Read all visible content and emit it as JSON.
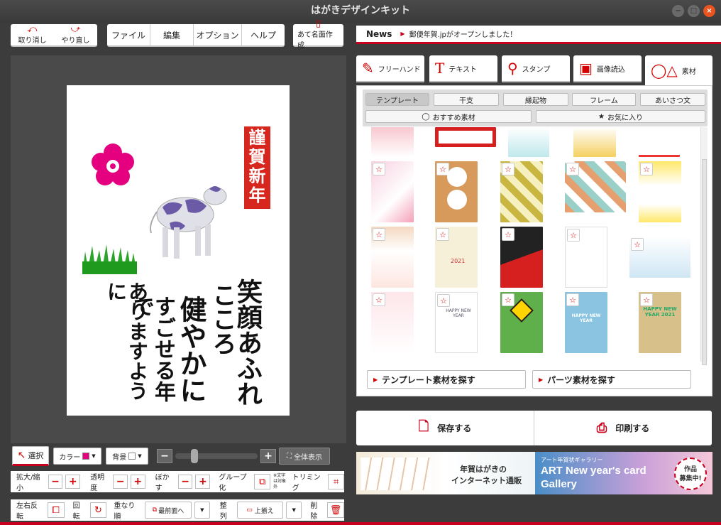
{
  "window": {
    "title": "はがきデザインキット",
    "controls": [
      "−",
      "□",
      "×"
    ]
  },
  "toolbar": {
    "undo_label": "取り消し",
    "redo_label": "やり直し",
    "menus": [
      "ファイル",
      "編集",
      "オプション",
      "ヘルプ"
    ],
    "address_label": "あて名面作成"
  },
  "news": {
    "label": "News",
    "text": "郵便年賀.jpがオープンしました！"
  },
  "card": {
    "stamp_text": "謹賀新年",
    "message_columns": [
      "笑顔あふれ",
      "こころ",
      "健やかに",
      "すごせる年で",
      "ありますように"
    ]
  },
  "tools": {
    "select_label": "選択",
    "color_label": "カラー",
    "bg_label": "背景",
    "fit_label": "全体表示",
    "scale_label": "拡大/縮小",
    "opacity_label": "透明度",
    "blur_label": "ぼかす",
    "group_label": "グループ化",
    "group_note": "※文字は対象外",
    "trim_label": "トリミング",
    "flip_label": "左右反転",
    "rotate_label": "回転",
    "order_label": "重なり順",
    "order_value": "最前面へ",
    "align_label": "整列",
    "align_value": "上揃え",
    "delete_label": "削除",
    "accent": "#e4007f"
  },
  "tabs": [
    {
      "label": "フリーハンド",
      "icon": "pen-icon"
    },
    {
      "label": "テキスト",
      "icon": "text-icon"
    },
    {
      "label": "スタンプ",
      "icon": "stamp-icon"
    },
    {
      "label": "画像読込",
      "icon": "image-icon"
    },
    {
      "label": "素材",
      "icon": "shapes-icon"
    }
  ],
  "categories": [
    "テンプレート",
    "干支",
    "縁起物",
    "フレーム",
    "あいさつ文"
  ],
  "subcategories": {
    "recommended": "おすすめ素材",
    "favorites": "お気に入り"
  },
  "find_buttons": {
    "templates": "テンプレート素材を探す",
    "parts": "パーツ素材を探す"
  },
  "actions": {
    "save": "保存する",
    "print": "印刷する"
  },
  "banners": {
    "left": {
      "line1": "年賀はがきの",
      "line2": "インターネット通販"
    },
    "right": {
      "small": "アート年賀状ギャラリー",
      "big1": "ART New year's card",
      "big2": "Gallery",
      "badge1": "作品",
      "badge2": "募集中!"
    }
  },
  "thumb_texts": [
    "2021",
    "HAPPY NEW YEAR",
    "HAPPY NEW YEAR",
    "HAPPY NEW YEAR 2021"
  ],
  "colors": {
    "brand_red": "#c8001e",
    "pink": "#e4007f"
  }
}
